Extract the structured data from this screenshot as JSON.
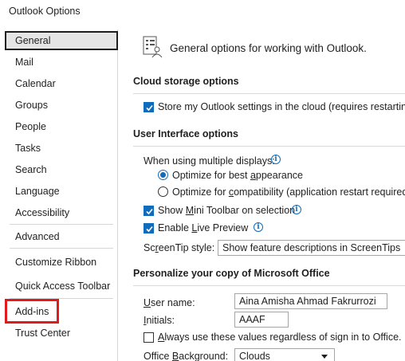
{
  "window": {
    "title": "Outlook Options"
  },
  "sidebar": {
    "items": [
      {
        "label": "General"
      },
      {
        "label": "Mail"
      },
      {
        "label": "Calendar"
      },
      {
        "label": "Groups"
      },
      {
        "label": "People"
      },
      {
        "label": "Tasks"
      },
      {
        "label": "Search"
      },
      {
        "label": "Language"
      },
      {
        "label": "Accessibility"
      },
      {
        "label": "Advanced"
      },
      {
        "label": "Customize Ribbon"
      },
      {
        "label": "Quick Access Toolbar"
      },
      {
        "label": "Add-ins"
      },
      {
        "label": "Trust Center"
      }
    ],
    "selected": "General",
    "highlighted": "Add-ins"
  },
  "main": {
    "header": "General options for working with Outlook.",
    "cloud": {
      "title": "Cloud storage options",
      "store_label": "Store my Outlook settings in the cloud (requires restarting Outlook)",
      "store_checked": true
    },
    "ui": {
      "title": "User Interface options",
      "multi_display_label": "When using multiple displays:",
      "opt_best_pre": "Optimize for best ",
      "opt_best_ul": "a",
      "opt_best_post": "ppearance",
      "opt_compat_pre": "Optimize for ",
      "opt_compat_ul": "c",
      "opt_compat_post": "ompatibility (application restart required)",
      "selected_option": "Optimize for best appearance",
      "mini_pre": "Show ",
      "mini_ul": "M",
      "mini_post": "ini Toolbar on selection",
      "mini_checked": true,
      "live_pre": "Enable ",
      "live_ul": "L",
      "live_post": "ive Preview",
      "live_checked": true,
      "screentip_pre": "Sc",
      "screentip_ul": "r",
      "screentip_post": "eenTip style:",
      "screentip_value": "Show feature descriptions in ScreenTips"
    },
    "personalize": {
      "title": "Personalize your copy of Microsoft Office",
      "username_ul": "U",
      "username_post": "ser name:",
      "username_value": "Aina Amisha Ahmad Fakrurrozi",
      "initials_ul": "I",
      "initials_post": "nitials:",
      "initials_value": "AAAF",
      "always_ul": "A",
      "always_post": "lways use these values regardless of sign in to Office.",
      "always_checked": false,
      "background_pre": "Office ",
      "background_ul": "B",
      "background_post": "ackground:",
      "background_value": "Clouds"
    }
  },
  "colors": {
    "accent": "#0f6cbd",
    "highlight_box": "#e01b1b",
    "selected_bg": "#e5e5e5"
  }
}
